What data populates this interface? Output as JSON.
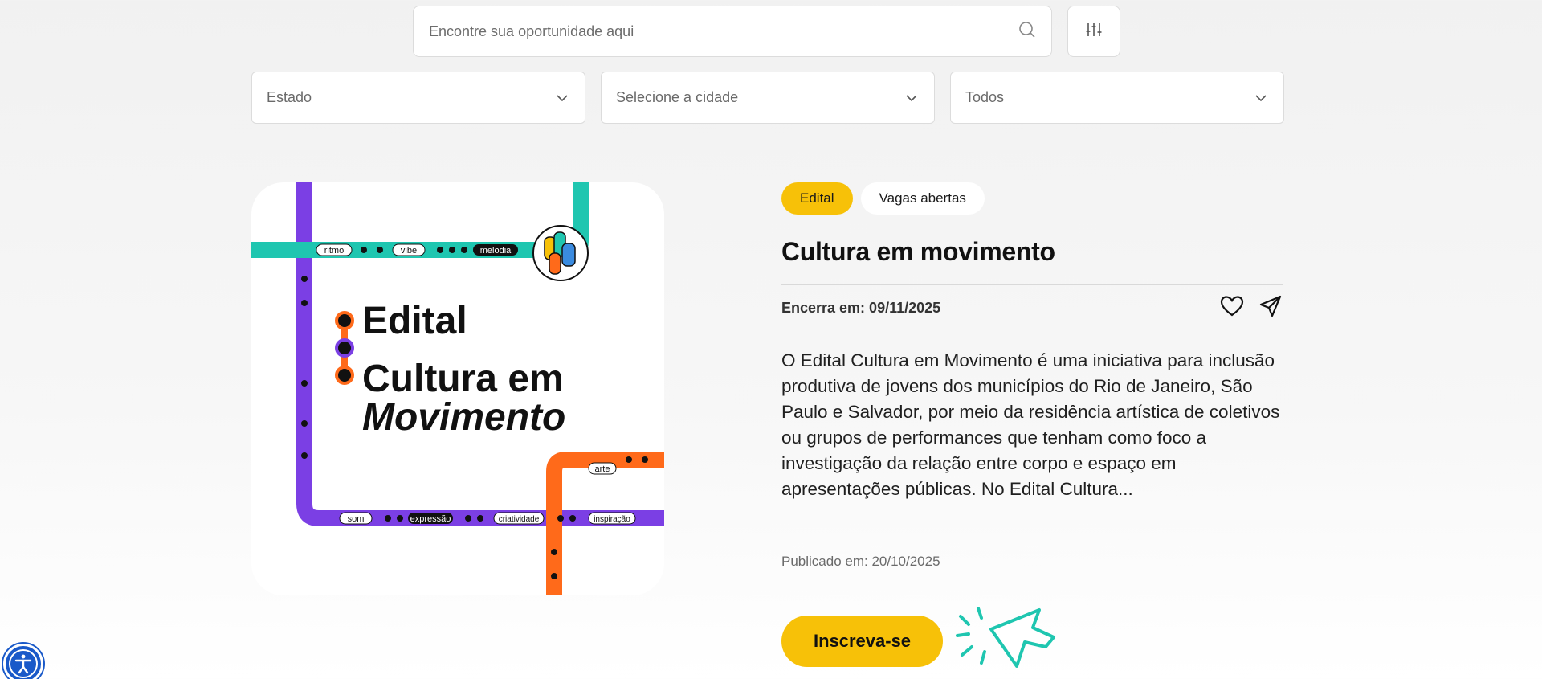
{
  "search": {
    "placeholder": "Encontre sua oportunidade aqui"
  },
  "filters": {
    "estado": "Estado",
    "cidade": "Selecione a cidade",
    "tipo": "Todos"
  },
  "cover": {
    "line1": "Edital",
    "line2": "Cultura em",
    "line3": "Movimento",
    "track_words": [
      "ritmo",
      "vibe",
      "melodia",
      "arte",
      "som",
      "expressão",
      "criatividade",
      "inspiração"
    ]
  },
  "opportunity": {
    "badge_type": "Edital",
    "badge_status": "Vagas abertas",
    "title": "Cultura em movimento",
    "closing": "Encerra em: 09/11/2025",
    "description": "O Edital Cultura em Movimento é uma iniciativa para inclusão produtiva de jovens dos municípios do Rio de Janeiro, São Paulo e Salvador, por meio da residência artística de coletivos ou grupos de performances que tenham como foco a investigação da relação entre corpo e espaço em apresentações públicas. No Edital Cultura...",
    "published": "Publicado em: 20/10/2025",
    "cta": "Inscreva-se"
  },
  "colors": {
    "accent": "#f7c108",
    "purple": "#7b3fe4",
    "teal": "#1fc6b0",
    "orange": "#ff6a1a",
    "a11y": "#1959c9"
  },
  "icons": [
    "search-icon",
    "sliders-icon",
    "chevron-down-icon",
    "heart-icon",
    "send-icon",
    "cursor-icon",
    "accessibility-icon"
  ]
}
